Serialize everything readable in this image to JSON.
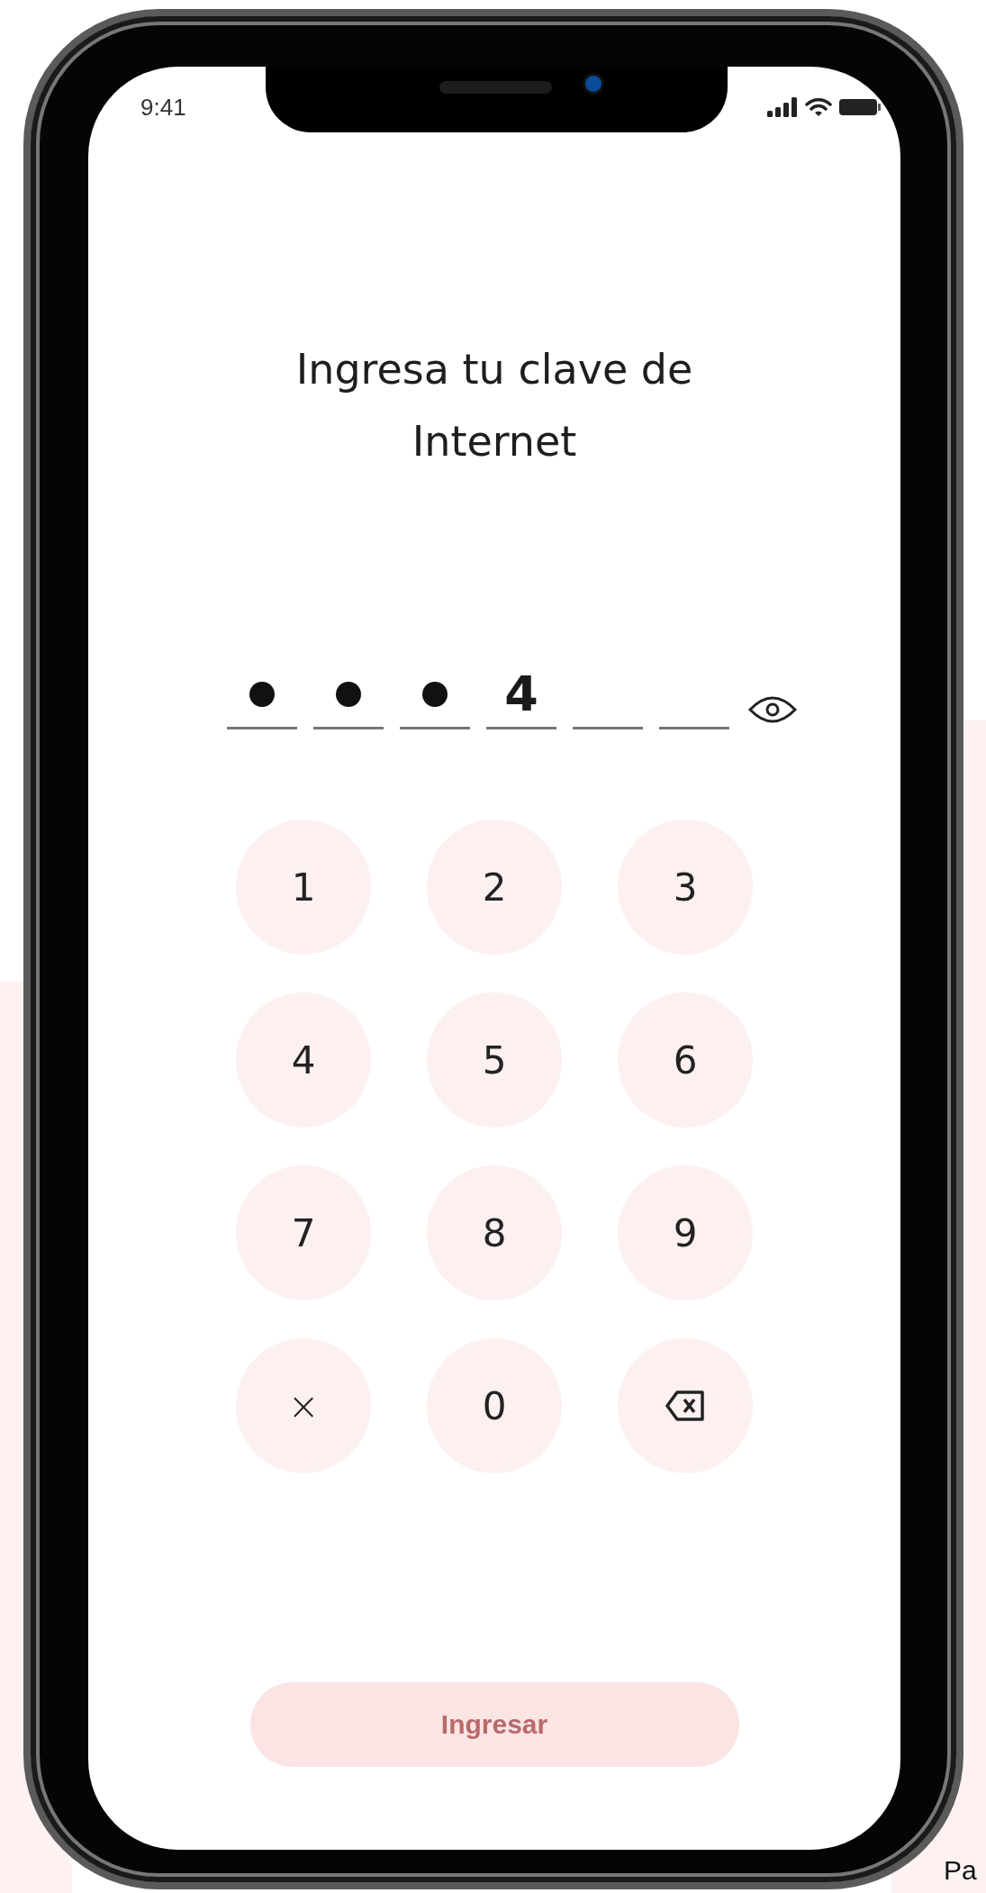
{
  "status_bar": {
    "time": "9:41"
  },
  "title": "Ingresa tu clave de Internet",
  "pin": {
    "slots": [
      {
        "kind": "masked"
      },
      {
        "kind": "masked"
      },
      {
        "kind": "masked"
      },
      {
        "kind": "digit",
        "value": "4"
      },
      {
        "kind": "empty"
      },
      {
        "kind": "empty"
      }
    ]
  },
  "keypad": {
    "keys": [
      {
        "kind": "digit",
        "label": "1"
      },
      {
        "kind": "digit",
        "label": "2"
      },
      {
        "kind": "digit",
        "label": "3"
      },
      {
        "kind": "digit",
        "label": "4"
      },
      {
        "kind": "digit",
        "label": "5"
      },
      {
        "kind": "digit",
        "label": "6"
      },
      {
        "kind": "digit",
        "label": "7"
      },
      {
        "kind": "digit",
        "label": "8"
      },
      {
        "kind": "digit",
        "label": "9"
      },
      {
        "kind": "clear",
        "label": "×"
      },
      {
        "kind": "digit",
        "label": "0"
      },
      {
        "kind": "backspace"
      }
    ]
  },
  "submit_button": {
    "label": "Ingresar",
    "disabled": true
  },
  "page_corner_text": "Pa"
}
